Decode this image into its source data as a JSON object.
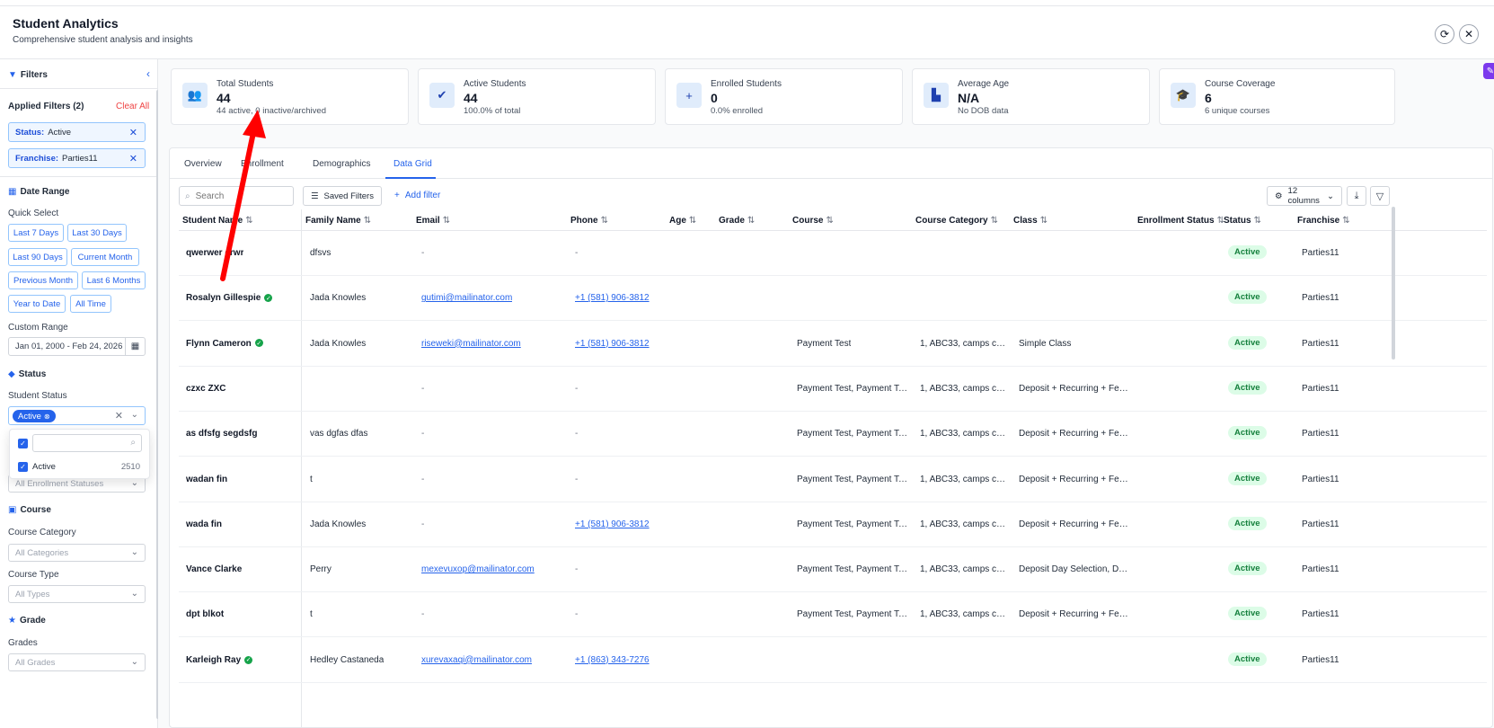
{
  "header": {
    "title": "Student Analytics",
    "subtitle": "Comprehensive student analysis and insights"
  },
  "sidebar": {
    "filters_title": "Filters",
    "applied_filters": "Applied Filters (2)",
    "clear_all": "Clear All",
    "chips": [
      {
        "key": "Status:",
        "value": "Active"
      },
      {
        "key": "Franchise:",
        "value": "Parties11"
      }
    ],
    "date_range_title": "Date Range",
    "quick_select_label": "Quick Select",
    "quick_buttons": [
      "Last 7 Days",
      "Last 30 Days",
      "Last 90 Days",
      "Current Month",
      "Previous Month",
      "Last 6 Months",
      "Year to Date",
      "All Time"
    ],
    "custom_range_label": "Custom Range",
    "custom_range_value": "Jan 01, 2000 - Feb 24, 2026",
    "status_title": "Status",
    "student_status_label": "Student Status",
    "student_status_selected": "Active",
    "status_options": [
      {
        "label": "Active",
        "count": "2510"
      }
    ],
    "enrollment_status_placeholder": "All Enrollment Statuses",
    "course_title": "Course",
    "course_category_label": "Course Category",
    "course_category_placeholder": "All Categories",
    "course_type_label": "Course Type",
    "course_type_placeholder": "All Types",
    "grade_title": "Grade",
    "grades_label": "Grades",
    "grades_placeholder": "All Grades"
  },
  "cards": [
    {
      "label": "Total Students",
      "value": "44",
      "sub": "44 active, 0 inactive/archived",
      "icon": "users-icon"
    },
    {
      "label": "Active Students",
      "value": "44",
      "sub": "100.0% of total",
      "icon": "user-check-icon"
    },
    {
      "label": "Enrolled Students",
      "value": "0",
      "sub": "0.0% enrolled",
      "icon": "user-plus-icon"
    },
    {
      "label": "Average Age",
      "value": "N/A",
      "sub": "No DOB data",
      "icon": "chart-icon"
    },
    {
      "label": "Course Coverage",
      "value": "6",
      "sub": "6 unique courses",
      "icon": "graduation-cap-icon"
    }
  ],
  "tabs": [
    "Overview",
    "Enrollment",
    "Demographics",
    "Data Grid"
  ],
  "active_tab": "Data Grid",
  "toolbar": {
    "search_placeholder": "Search",
    "saved_filters": "Saved Filters",
    "add_filter": "Add filter",
    "columns": "12 columns"
  },
  "columns": [
    "Student Name",
    "Family Name",
    "Email",
    "Phone",
    "Age",
    "Grade",
    "Course",
    "Course Category",
    "Class",
    "Enrollment Status",
    "Status",
    "Franchise"
  ],
  "rows": [
    {
      "name": "qwerwer erwr",
      "verified": false,
      "family": "dfsvs",
      "email": "-",
      "phone": "-",
      "course": "",
      "category": "",
      "class": "",
      "status": "Active",
      "franchise": "Parties11"
    },
    {
      "name": "Rosalyn Gillespie",
      "verified": true,
      "family": "Jada Knowles",
      "email": "gutimi@mailinator.com",
      "phone": "+1 (581) 906-3812",
      "course": "",
      "category": "",
      "class": "",
      "status": "Active",
      "franchise": "Parties11"
    },
    {
      "name": "Flynn Cameron",
      "verified": true,
      "family": "Jada Knowles",
      "email": "riseweki@mailinator.com",
      "phone": "+1 (581) 906-3812",
      "course": "Payment Test",
      "category": "1, ABC33, camps cat...",
      "class": "Simple Class",
      "status": "Active",
      "franchise": "Parties11"
    },
    {
      "name": "czxc ZXC",
      "verified": false,
      "family": "",
      "email": "-",
      "phone": "-",
      "course": "Payment Test, Payment Te...",
      "category": "1, ABC33, camps cat...",
      "class": "Deposit + Recurring + Fee ...",
      "status": "Active",
      "franchise": "Parties11"
    },
    {
      "name": "as dfsfg segdsfg",
      "verified": false,
      "family": "vas dgfas dfas",
      "email": "-",
      "phone": "-",
      "course": "Payment Test, Payment Te...",
      "category": "1, ABC33, camps cat...",
      "class": "Deposit + Recurring + Fee ...",
      "status": "Active",
      "franchise": "Parties11"
    },
    {
      "name": "wadan fin",
      "verified": false,
      "family": "t",
      "email": "-",
      "phone": "-",
      "course": "Payment Test, Payment Te...",
      "category": "1, ABC33, camps cat...",
      "class": "Deposit + Recurring + Fee ...",
      "status": "Active",
      "franchise": "Parties11"
    },
    {
      "name": "wada fin",
      "verified": false,
      "family": "Jada Knowles",
      "email": "-",
      "phone": "+1 (581) 906-3812",
      "course": "Payment Test, Payment Te...",
      "category": "1, ABC33, camps cat...",
      "class": "Deposit + Recurring + Fee ...",
      "status": "Active",
      "franchise": "Parties11"
    },
    {
      "name": "Vance Clarke",
      "verified": false,
      "family": "Perry",
      "email": "mexevuxop@mailinator.com",
      "phone": "-",
      "course": "Payment Test, Payment Te...",
      "category": "1, ABC33, camps cat...",
      "class": "Deposit Day Selection, De...",
      "status": "Active",
      "franchise": "Parties11"
    },
    {
      "name": "dpt blkot",
      "verified": false,
      "family": "t",
      "email": "-",
      "phone": "-",
      "course": "Payment Test, Payment Te...",
      "category": "1, ABC33, camps cat...",
      "class": "Deposit + Recurring + Fee ...",
      "status": "Active",
      "franchise": "Parties11"
    },
    {
      "name": "Karleigh Ray",
      "verified": true,
      "family": "Hedley Castaneda",
      "email": "xurevaxaqi@mailinator.com",
      "phone": "+1 (863) 343-7276",
      "course": "",
      "category": "",
      "class": "",
      "status": "Active",
      "franchise": "Parties11"
    }
  ],
  "colors": {
    "accent": "#2563eb",
    "active_badge_bg": "#dcfce7",
    "active_badge_text": "#15803d",
    "annotation_arrow": "#ff0000"
  }
}
